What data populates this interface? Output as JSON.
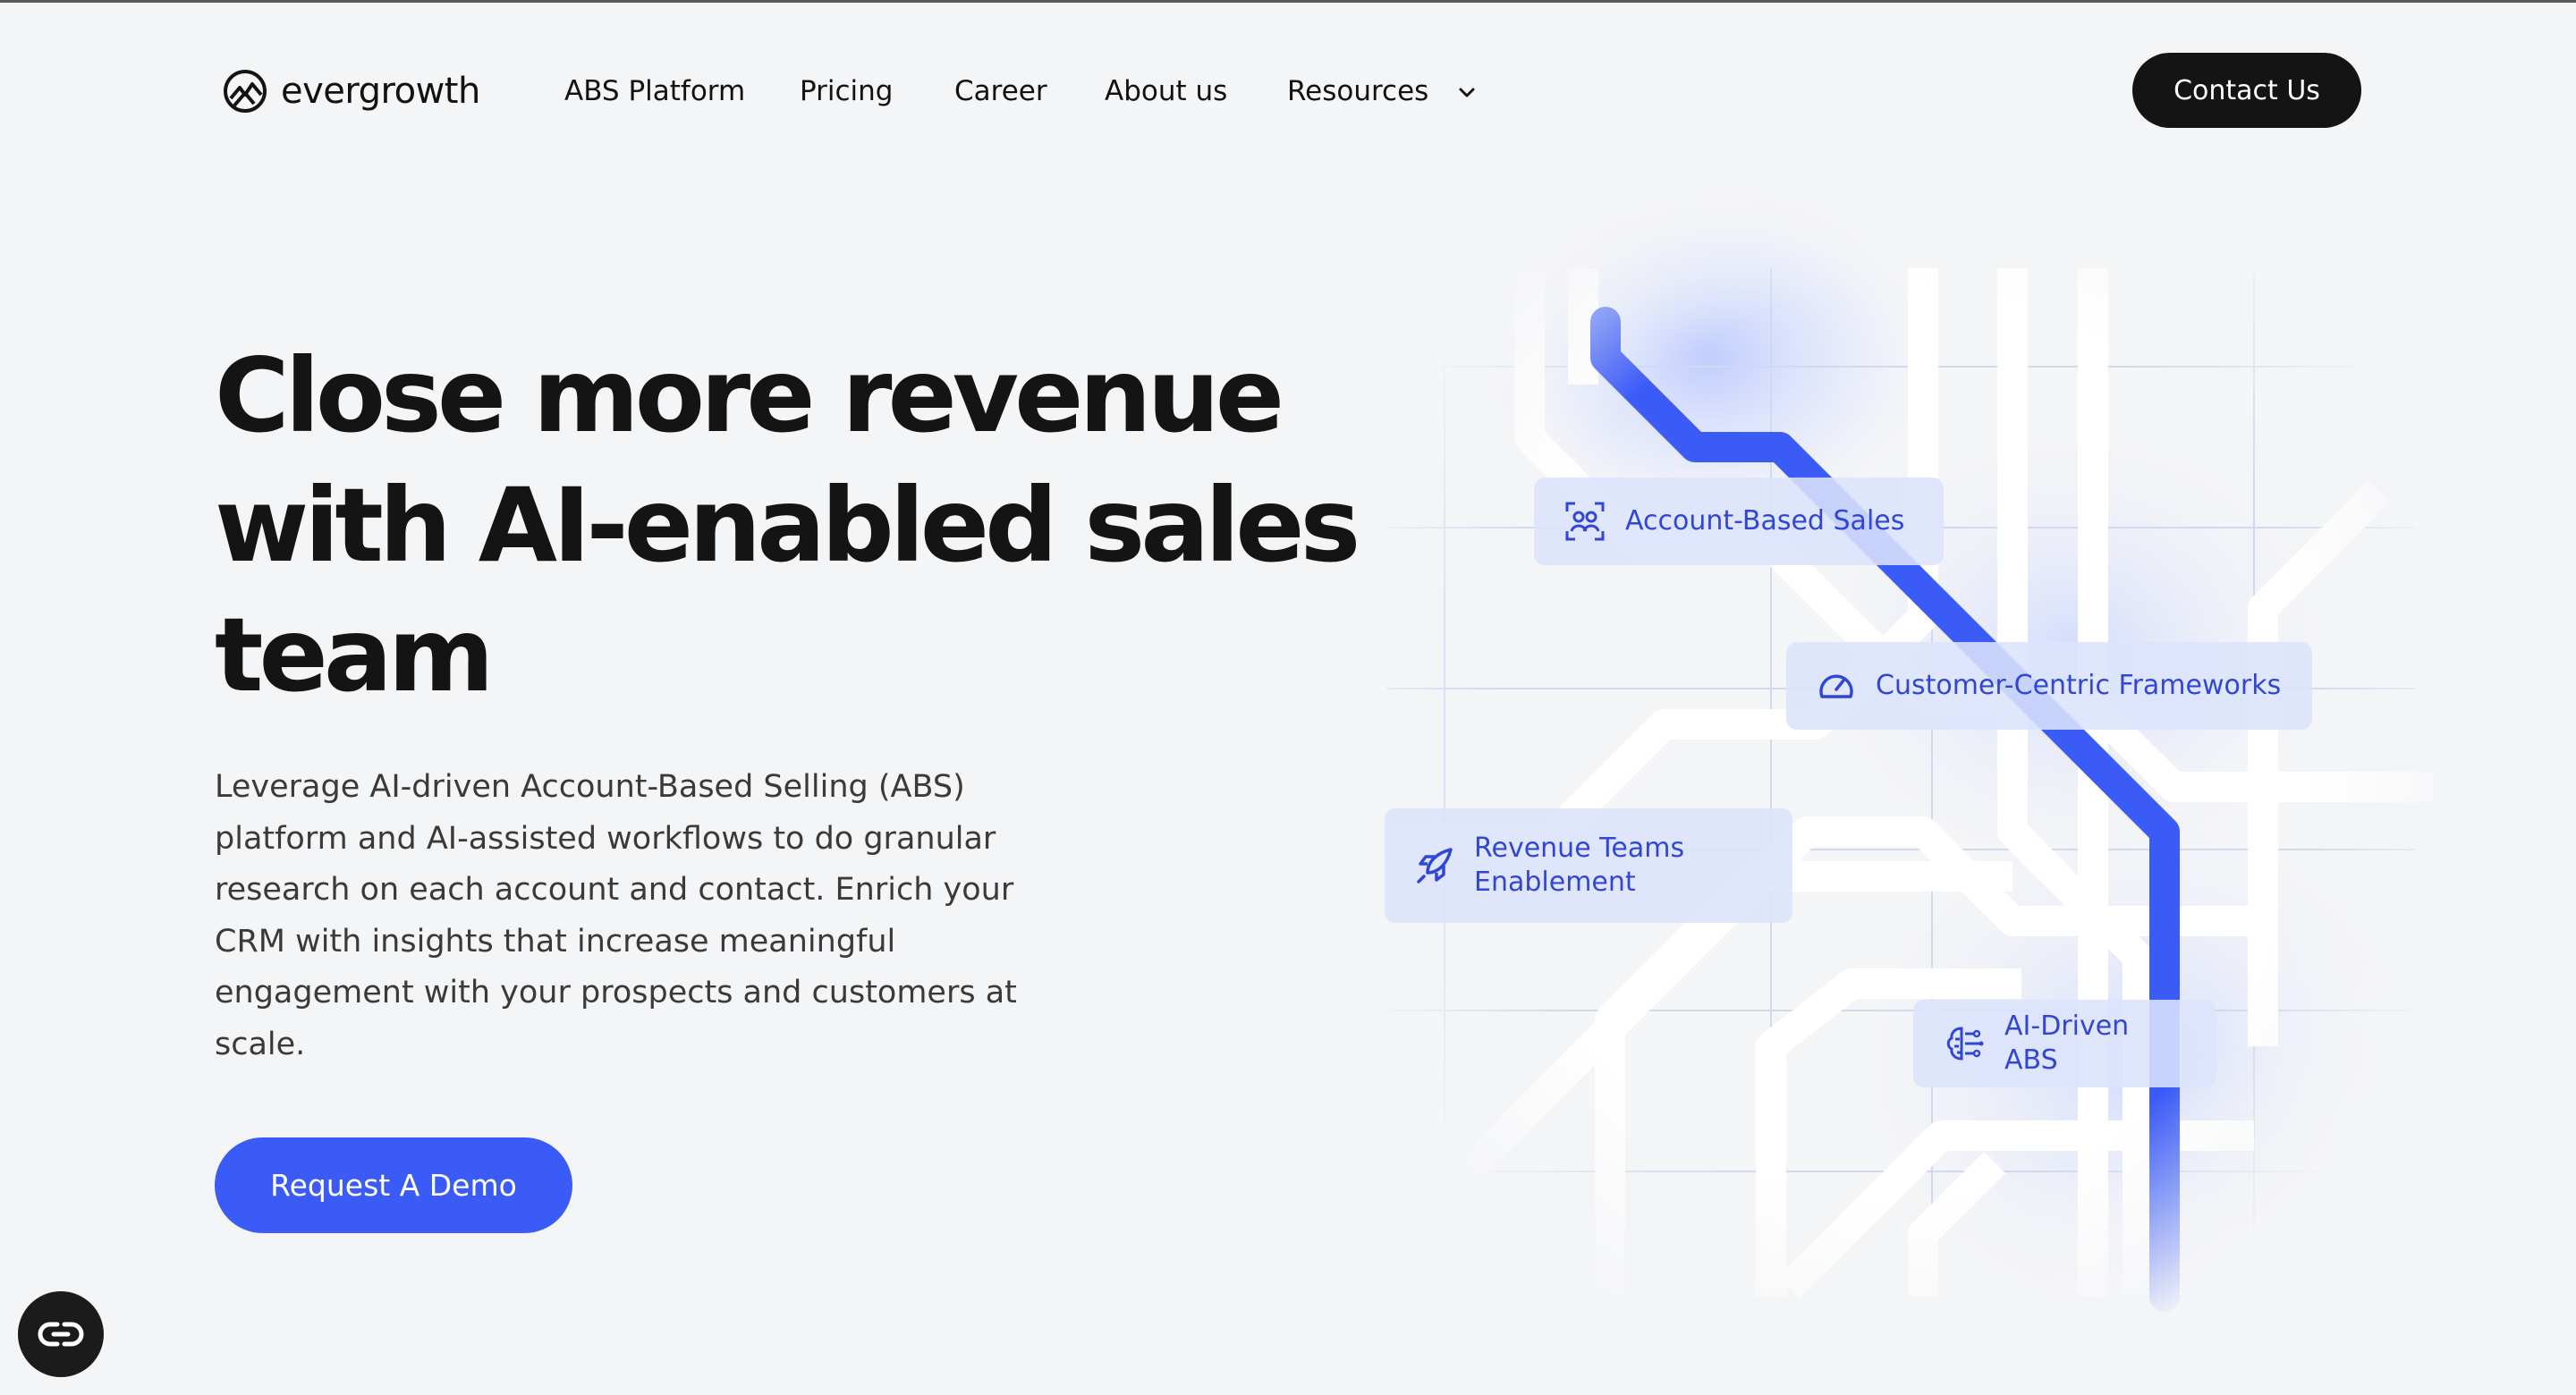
{
  "header": {
    "brand": "evergrowth",
    "nav": [
      {
        "label": "ABS Platform"
      },
      {
        "label": "Pricing"
      },
      {
        "label": "Career"
      },
      {
        "label": "About us"
      },
      {
        "label": "Resources"
      }
    ],
    "contact_label": "Contact Us"
  },
  "hero": {
    "title_lines": [
      "Close more revenue",
      "with AI-enabled sales",
      "team"
    ],
    "description": "Leverage AI-driven Account-Based Selling (ABS) platform and AI-assisted workflows to do granular research on each account and contact. Enrich your CRM with insights that increase meaningful engagement with your prospects and customers at scale.",
    "cta_label": "Request A Demo"
  },
  "graphic": {
    "pills": [
      {
        "label": "Account-Based Sales",
        "icon": "user-focus-icon"
      },
      {
        "label": "Customer-Centric Frameworks",
        "icon": "gauge-icon"
      },
      {
        "label": "Revenue Teams Enablement",
        "icon": "rocket-icon"
      },
      {
        "label": "AI-Driven ABS",
        "icon": "ai-brain-icon"
      }
    ],
    "accent_color": "#3b5bf6"
  },
  "floating": {
    "icon": "link-icon"
  }
}
